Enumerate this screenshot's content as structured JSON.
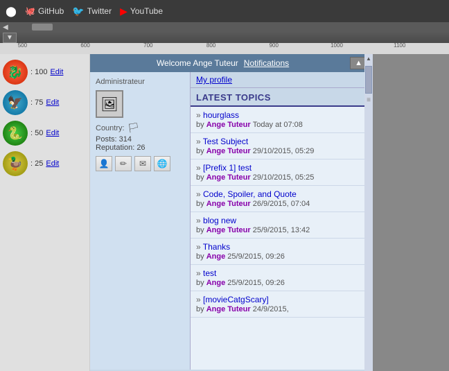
{
  "browser": {
    "github_label": "GitHub",
    "twitter_label": "Twitter",
    "youtube_label": "YouTube"
  },
  "toolbar": {
    "dropdown_label": "▼"
  },
  "ruler": {
    "numbers": [
      "500",
      "600",
      "700",
      "800",
      "900",
      "1000",
      "1100"
    ]
  },
  "header": {
    "welcome_text": "Welcome Ange Tuteur",
    "notifications_label": "Notifications",
    "up_arrow": "▲",
    "my_profile_label": "My profile"
  },
  "user": {
    "role": "Administrateur",
    "avatar_emoji": "🖼",
    "country_label": "Country:",
    "country_flag": "🏳",
    "posts_label": "Posts: 314",
    "rep_label": "Reputation: 26",
    "actions": {
      "profile_icon": "👤",
      "edit_icon": "✏",
      "message_icon": "✉",
      "web_icon": "🌐"
    }
  },
  "ranks": [
    {
      "emoji": "🔴",
      "color": "#cc2200",
      "points": ": 100",
      "edit": "Edit"
    },
    {
      "emoji": "🔵",
      "color": "#006699",
      "points": ": 75",
      "edit": "Edit"
    },
    {
      "emoji": "🟢",
      "color": "#116600",
      "points": ": 50",
      "edit": "Edit"
    },
    {
      "emoji": "🟡",
      "color": "#888800",
      "points": ": 25",
      "edit": "Edit"
    }
  ],
  "latest_topics": {
    "header": "LATEST TOPICS",
    "items": [
      {
        "title": "hourglass",
        "by_label": "by",
        "author": "Ange Tuteur",
        "date": "Today at 07:08"
      },
      {
        "title": "Test Subject",
        "by_label": "by",
        "author": "Ange Tuteur",
        "date": "29/10/2015, 05:29"
      },
      {
        "title": "[Prefix 1] test",
        "by_label": "by",
        "author": "Ange Tuteur",
        "date": "29/10/2015, 05:25"
      },
      {
        "title": "Code, Spoiler, and Quote",
        "by_label": "by",
        "author": "Ange Tuteur",
        "date": "26/9/2015, 07:04"
      },
      {
        "title": "blog new",
        "by_label": "by",
        "author": "Ange Tuteur",
        "date": "25/9/2015, 13:42"
      },
      {
        "title": "Thanks",
        "by_label": "by",
        "author": "Ange",
        "date": "25/9/2015, 09:26"
      },
      {
        "title": "test",
        "by_label": "by",
        "author": "Ange",
        "date": "25/9/2015, 09:26"
      },
      {
        "title": "[movieCatgScary]",
        "by_label": "by",
        "author": "Ange Tuteur",
        "date": "24/9/2015,"
      }
    ]
  }
}
